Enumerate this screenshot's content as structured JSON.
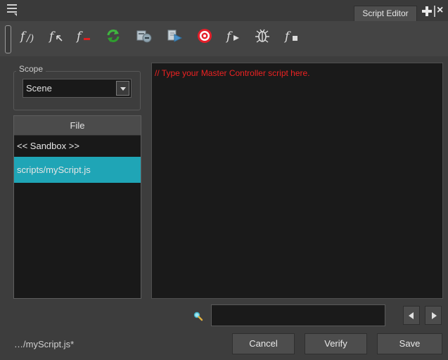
{
  "tab": {
    "title": "Script Editor"
  },
  "toolbar": {
    "tools": [
      {
        "name": "function-new-icon"
      },
      {
        "name": "function-rename-icon"
      },
      {
        "name": "function-delete-icon"
      },
      {
        "name": "refresh-icon"
      },
      {
        "name": "import-script-icon"
      },
      {
        "name": "run-configuration-icon"
      },
      {
        "name": "target-icon"
      },
      {
        "name": "run-function-icon"
      },
      {
        "name": "debug-icon"
      },
      {
        "name": "stop-function-icon"
      }
    ]
  },
  "scope": {
    "label": "Scope",
    "selected": "Scene"
  },
  "file_panel": {
    "header": "File",
    "items": [
      {
        "label": "<< Sandbox >>",
        "selected": false
      },
      {
        "label": "scripts/myScript.js",
        "selected": true
      }
    ]
  },
  "editor": {
    "code": "// Type your Master Controller script here."
  },
  "search": {
    "value": ""
  },
  "footer": {
    "status": "…/myScript.js*",
    "cancel_label": "Cancel",
    "verify_label": "Verify",
    "save_label": "Save"
  },
  "colors": {
    "selection": "#1fa5b6",
    "code_text": "#ee2222",
    "background": "#3d3d3d"
  }
}
